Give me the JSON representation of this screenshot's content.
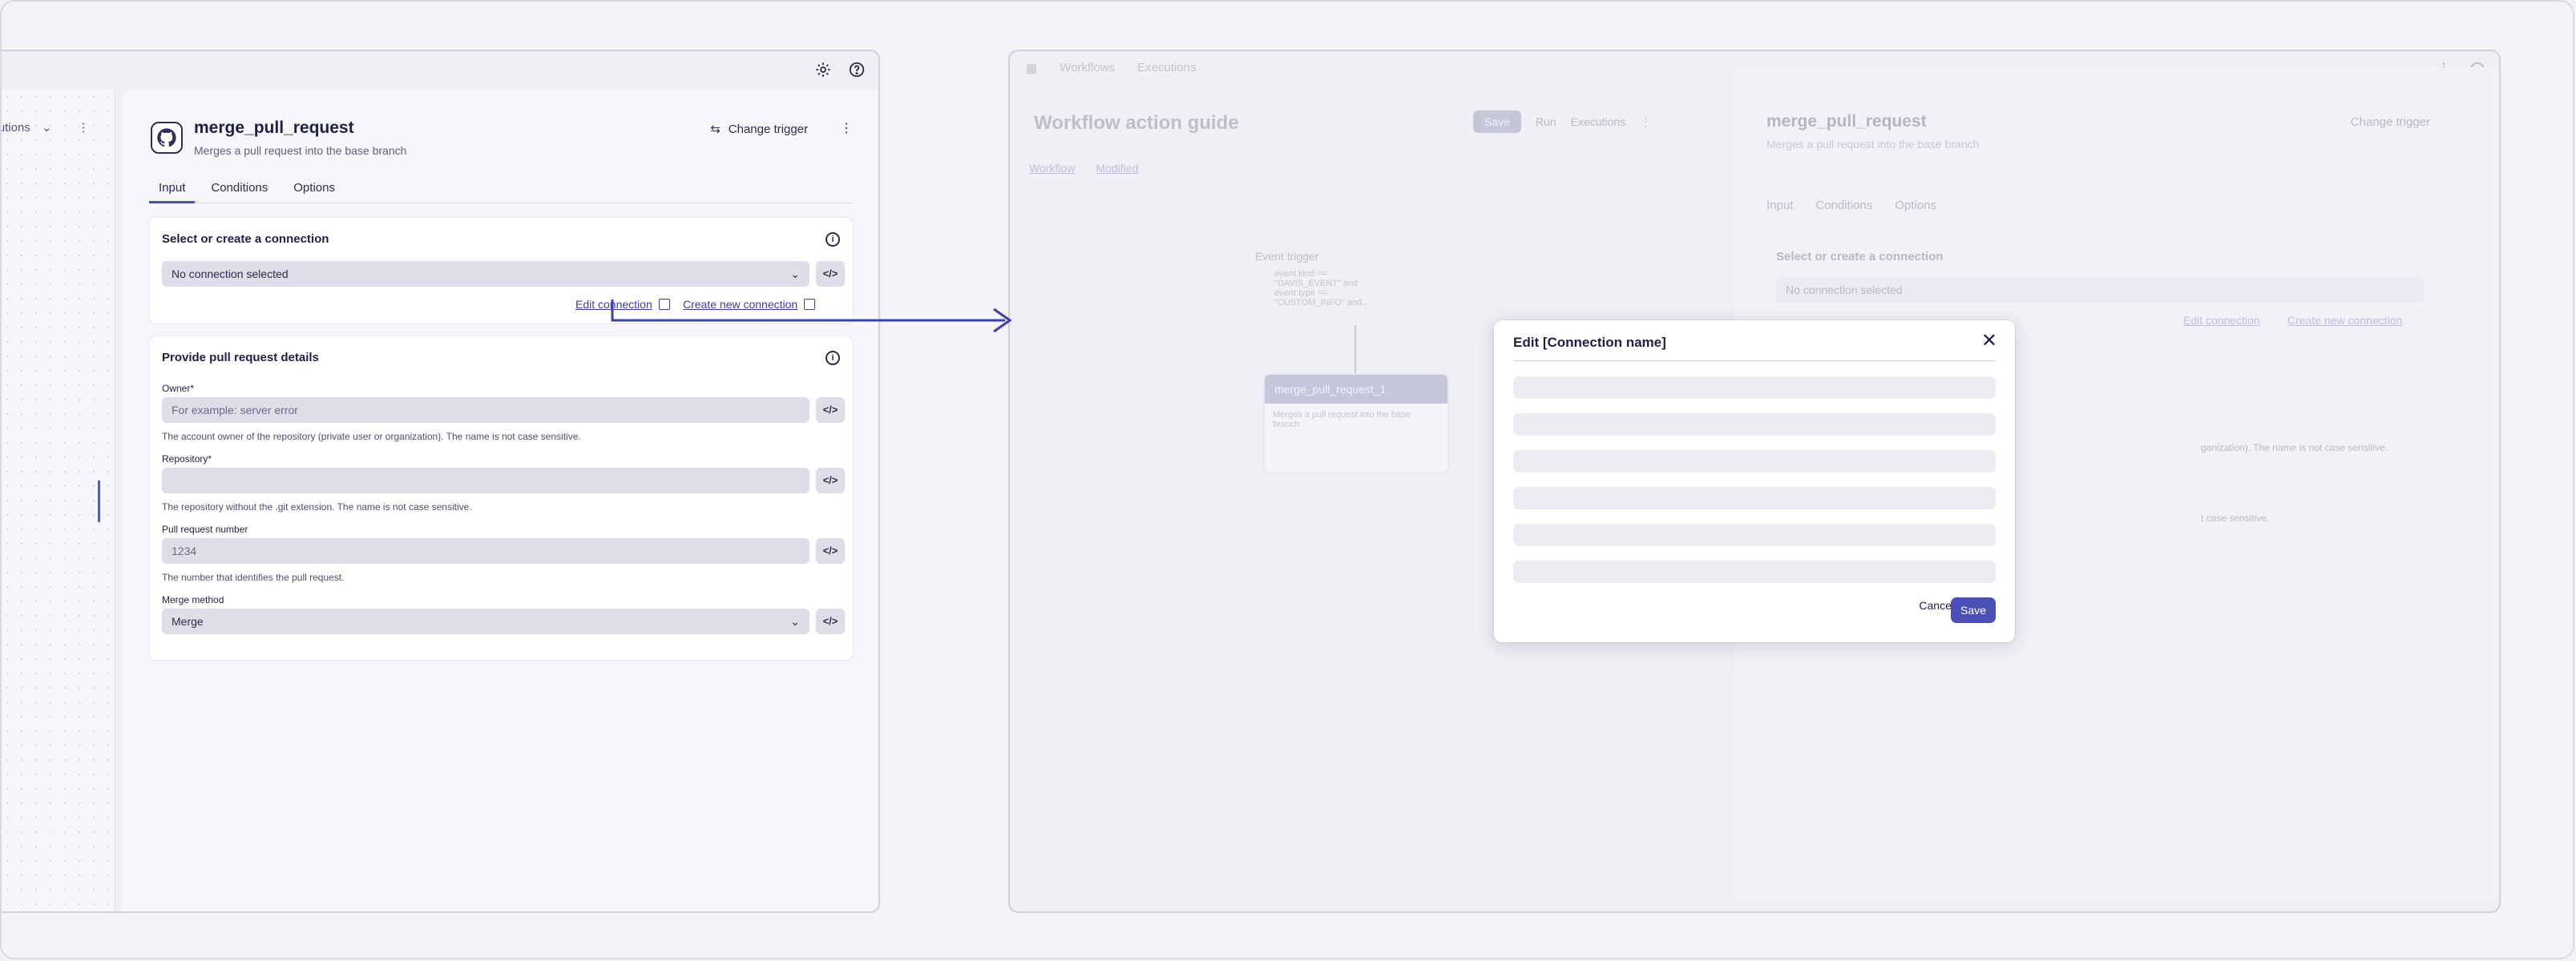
{
  "left": {
    "ghost_tab_label": "ecutions",
    "panel": {
      "title": "merge_pull_request",
      "subtitle": "Merges a pull request into the base branch",
      "change_trigger": "Change trigger",
      "tabs": [
        "Input",
        "Conditions",
        "Options"
      ],
      "connection_card": {
        "title": "Select or create a connection",
        "select_value": "No connection selected",
        "edit_link": "Edit connection",
        "create_link": "Create new connection"
      },
      "details_card": {
        "title": "Provide pull request details",
        "owner_label": "Owner*",
        "owner_placeholder": "For example: server error",
        "owner_hint": "The account owner of the repository (private user or organization). The name is not case sensitive.",
        "repo_label": "Repository*",
        "repo_value": "",
        "repo_hint": "The repository without the .git extension. The name is not case sensitive.",
        "pr_label": "Pull request number",
        "pr_value": "1234",
        "pr_hint": "The number that identifies the pull request.",
        "merge_label": "Merge method",
        "merge_value": "Merge"
      },
      "code_button": "</>"
    }
  },
  "right": {
    "tabs": [
      "Workflows",
      "Executions"
    ],
    "title": "Workflow action guide",
    "save": "Save",
    "run": "Run",
    "executions": "Executions",
    "links": [
      "Workflow",
      "Modified"
    ],
    "event_node": {
      "title": "Event trigger",
      "line1": "event.kind == \"DAVIS_EVENT\" and",
      "line2": "event.type == \"CUSTOM_INFO\" and..."
    },
    "action_node": {
      "title": "merge_pull_request_1",
      "desc": "Merges a pull request into the base branch"
    },
    "panel": {
      "title": "merge_pull_request",
      "subtitle": "Merges a pull request into the base branch",
      "change_trigger": "Change trigger",
      "tabs": [
        "Input",
        "Conditions",
        "Options"
      ],
      "conn_title": "Select or create a connection",
      "select_value": "No connection selected",
      "edit_link": "Edit connection",
      "create_link": "Create new connection",
      "hint1": "ganization). The name is not case sensitive.",
      "hint2": "t case sensitive."
    }
  },
  "modal": {
    "title": "Edit [Connection name]",
    "cancel": "Cancel",
    "save": "Save"
  },
  "colors": {
    "accent": "#4b4fb6",
    "connector": "#3e41a6"
  }
}
